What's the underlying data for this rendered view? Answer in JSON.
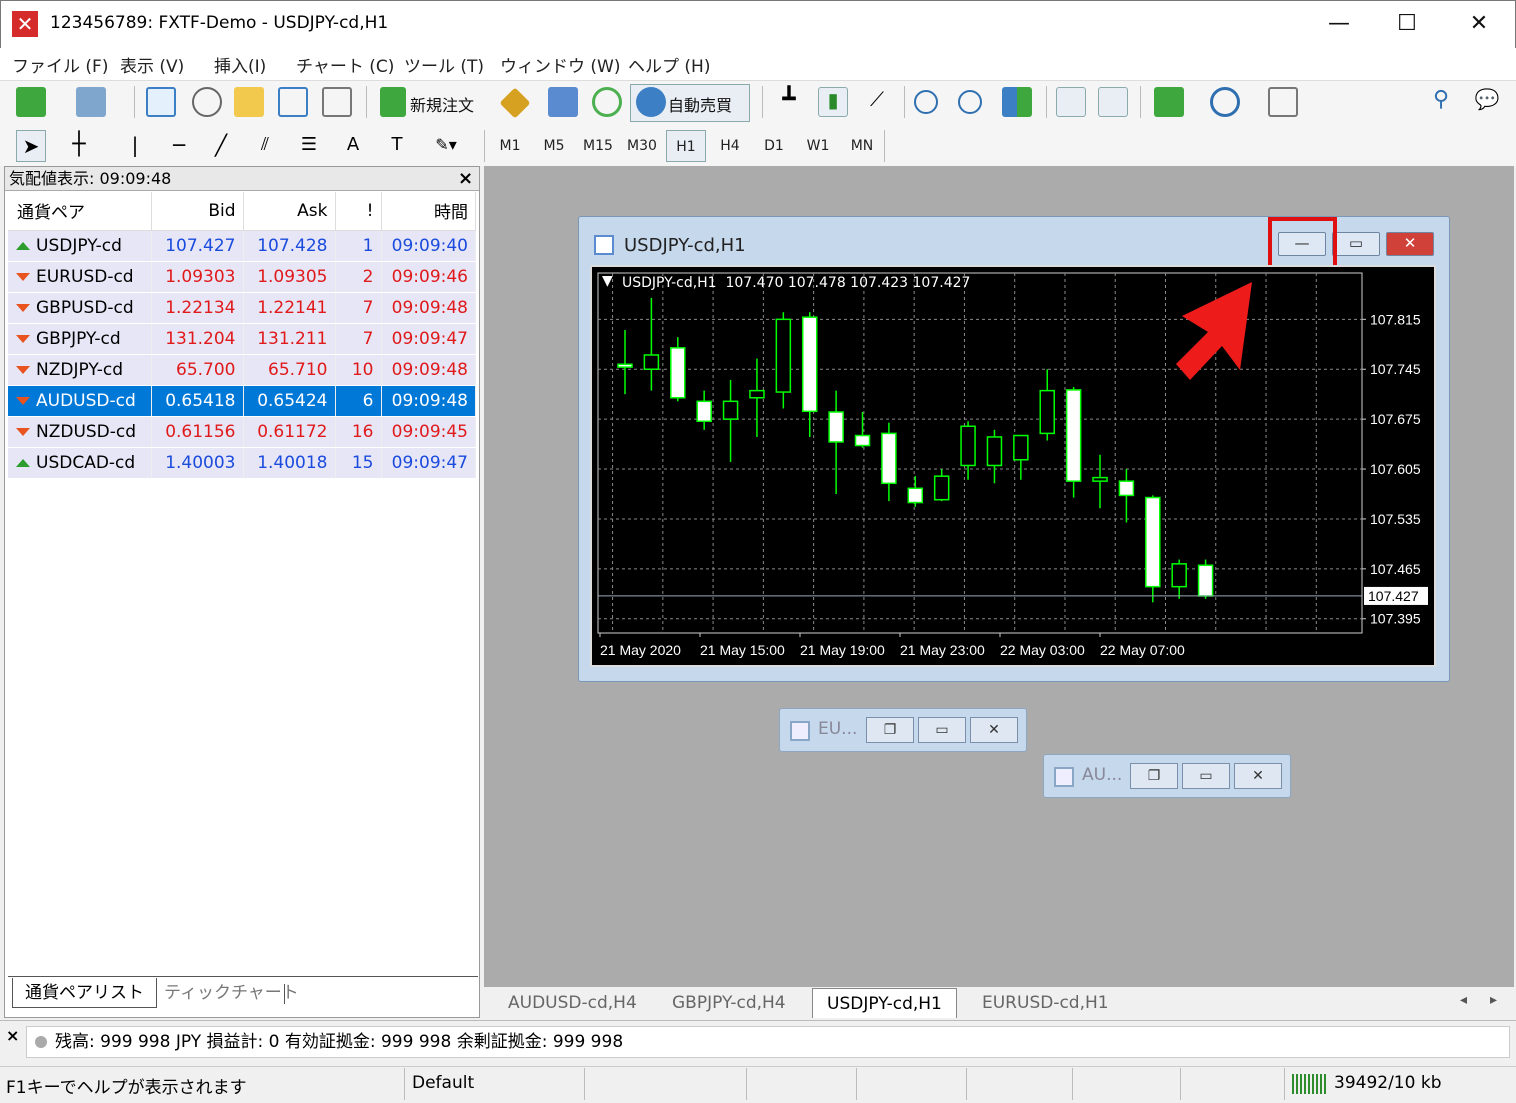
{
  "window": {
    "title": "123456789: FXTF-Demo - USDJPY-cd,H1",
    "minimize": "—",
    "maximize": "☐",
    "close": "✕"
  },
  "menu": [
    "ファイル (F)",
    "表示 (V)",
    "挿入(I)",
    "チャート (C)",
    "ツール (T)",
    "ウィンドウ (W)",
    "ヘルプ (H)"
  ],
  "toolbar": {
    "new_order": "新規注文",
    "auto_trade": "自動売買"
  },
  "timeframes": [
    "M1",
    "M5",
    "M15",
    "M30",
    "H1",
    "H4",
    "D1",
    "W1",
    "MN"
  ],
  "active_timeframe": "H1",
  "market_watch": {
    "title": "気配値表示: 09:09:48",
    "close": "×",
    "headers": {
      "pair": "通貨ペア",
      "bid": "Bid",
      "ask": "Ask",
      "spread": "!",
      "time": "時間"
    },
    "rows": [
      {
        "symbol": "USDJPY-cd",
        "bid": "107.427",
        "ask": "107.428",
        "spread": "1",
        "time": "09:09:40",
        "dir": "up"
      },
      {
        "symbol": "EURUSD-cd",
        "bid": "1.09303",
        "ask": "1.09305",
        "spread": "2",
        "time": "09:09:46",
        "dir": "down"
      },
      {
        "symbol": "GBPUSD-cd",
        "bid": "1.22134",
        "ask": "1.22141",
        "spread": "7",
        "time": "09:09:48",
        "dir": "down"
      },
      {
        "symbol": "GBPJPY-cd",
        "bid": "131.204",
        "ask": "131.211",
        "spread": "7",
        "time": "09:09:47",
        "dir": "down"
      },
      {
        "symbol": "NZDJPY-cd",
        "bid": "65.700",
        "ask": "65.710",
        "spread": "10",
        "time": "09:09:48",
        "dir": "down"
      },
      {
        "symbol": "AUDUSD-cd",
        "bid": "0.65418",
        "ask": "0.65424",
        "spread": "6",
        "time": "09:09:48",
        "dir": "down",
        "selected": true
      },
      {
        "symbol": "NZDUSD-cd",
        "bid": "0.61156",
        "ask": "0.61172",
        "spread": "16",
        "time": "09:09:45",
        "dir": "down"
      },
      {
        "symbol": "USDCAD-cd",
        "bid": "1.40003",
        "ask": "1.40018",
        "spread": "15",
        "time": "09:09:47",
        "dir": "up"
      }
    ],
    "tabs": [
      "通貨ペアリスト",
      "ティックチャート"
    ]
  },
  "chart_window": {
    "title": "USDJPY-cd,H1",
    "info": "USDJPY-cd,H1  107.470 107.478 107.423 107.427",
    "current_price": "107.427",
    "y_ticks": [
      "107.815",
      "107.745",
      "107.675",
      "107.605",
      "107.535",
      "107.465",
      "107.395"
    ],
    "x_ticks": [
      "21 May 2020",
      "21 May 15:00",
      "21 May 19:00",
      "21 May 23:00",
      "22 May 03:00",
      "22 May 07:00"
    ]
  },
  "chart_data": {
    "type": "candlestick",
    "ylim": [
      107.375,
      107.88
    ],
    "candles": [
      {
        "o": 107.752,
        "h": 107.8,
        "l": 107.71,
        "c": 107.748
      },
      {
        "o": 107.745,
        "h": 107.845,
        "l": 107.715,
        "c": 107.765
      },
      {
        "o": 107.775,
        "h": 107.79,
        "l": 107.7,
        "c": 107.705
      },
      {
        "o": 107.7,
        "h": 107.715,
        "l": 107.66,
        "c": 107.672
      },
      {
        "o": 107.675,
        "h": 107.73,
        "l": 107.615,
        "c": 107.7
      },
      {
        "o": 107.705,
        "h": 107.76,
        "l": 107.65,
        "c": 107.715
      },
      {
        "o": 107.713,
        "h": 107.825,
        "l": 107.69,
        "c": 107.815
      },
      {
        "o": 107.818,
        "h": 107.825,
        "l": 107.65,
        "c": 107.686
      },
      {
        "o": 107.685,
        "h": 107.715,
        "l": 107.57,
        "c": 107.643
      },
      {
        "o": 107.652,
        "h": 107.685,
        "l": 107.635,
        "c": 107.638
      },
      {
        "o": 107.655,
        "h": 107.67,
        "l": 107.56,
        "c": 107.585
      },
      {
        "o": 107.578,
        "h": 107.595,
        "l": 107.552,
        "c": 107.558
      },
      {
        "o": 107.562,
        "h": 107.605,
        "l": 107.56,
        "c": 107.595
      },
      {
        "o": 107.61,
        "h": 107.672,
        "l": 107.59,
        "c": 107.665
      },
      {
        "o": 107.61,
        "h": 107.66,
        "l": 107.585,
        "c": 107.65
      },
      {
        "o": 107.618,
        "h": 107.648,
        "l": 107.59,
        "c": 107.652
      },
      {
        "o": 107.655,
        "h": 107.745,
        "l": 107.645,
        "c": 107.715
      },
      {
        "o": 107.716,
        "h": 107.72,
        "l": 107.565,
        "c": 107.588
      },
      {
        "o": 107.588,
        "h": 107.625,
        "l": 107.55,
        "c": 107.593
      },
      {
        "o": 107.588,
        "h": 107.605,
        "l": 107.53,
        "c": 107.568
      },
      {
        "o": 107.565,
        "h": 107.568,
        "l": 107.418,
        "c": 107.44
      },
      {
        "o": 107.44,
        "h": 107.478,
        "l": 107.423,
        "c": 107.472
      },
      {
        "o": 107.47,
        "h": 107.478,
        "l": 107.423,
        "c": 107.427
      }
    ]
  },
  "minimized": [
    {
      "title": "EU..."
    },
    {
      "title": "AU..."
    }
  ],
  "chart_tabs": [
    "AUDUSD-cd,H4",
    "GBPJPY-cd,H4",
    "USDJPY-cd,H1",
    "EURUSD-cd,H1"
  ],
  "active_chart_tab": "USDJPY-cd,H1",
  "terminal": {
    "close": "×",
    "text": "残高: 999 998 JPY  損益計: 0  有効証拠金: 999 998  余剰証拠金: 999 998"
  },
  "statusbar": {
    "help": "F1キーでヘルプが表示されます",
    "profile": "Default",
    "traffic": "39492/10 kb"
  },
  "colors": {
    "bullish": "#00ff00",
    "chart_bg": "#000000",
    "selection": "#0078d7",
    "bid_blue": "#1b4bdd",
    "bid_red": "#e01a1a",
    "highlight": "#e01010"
  }
}
